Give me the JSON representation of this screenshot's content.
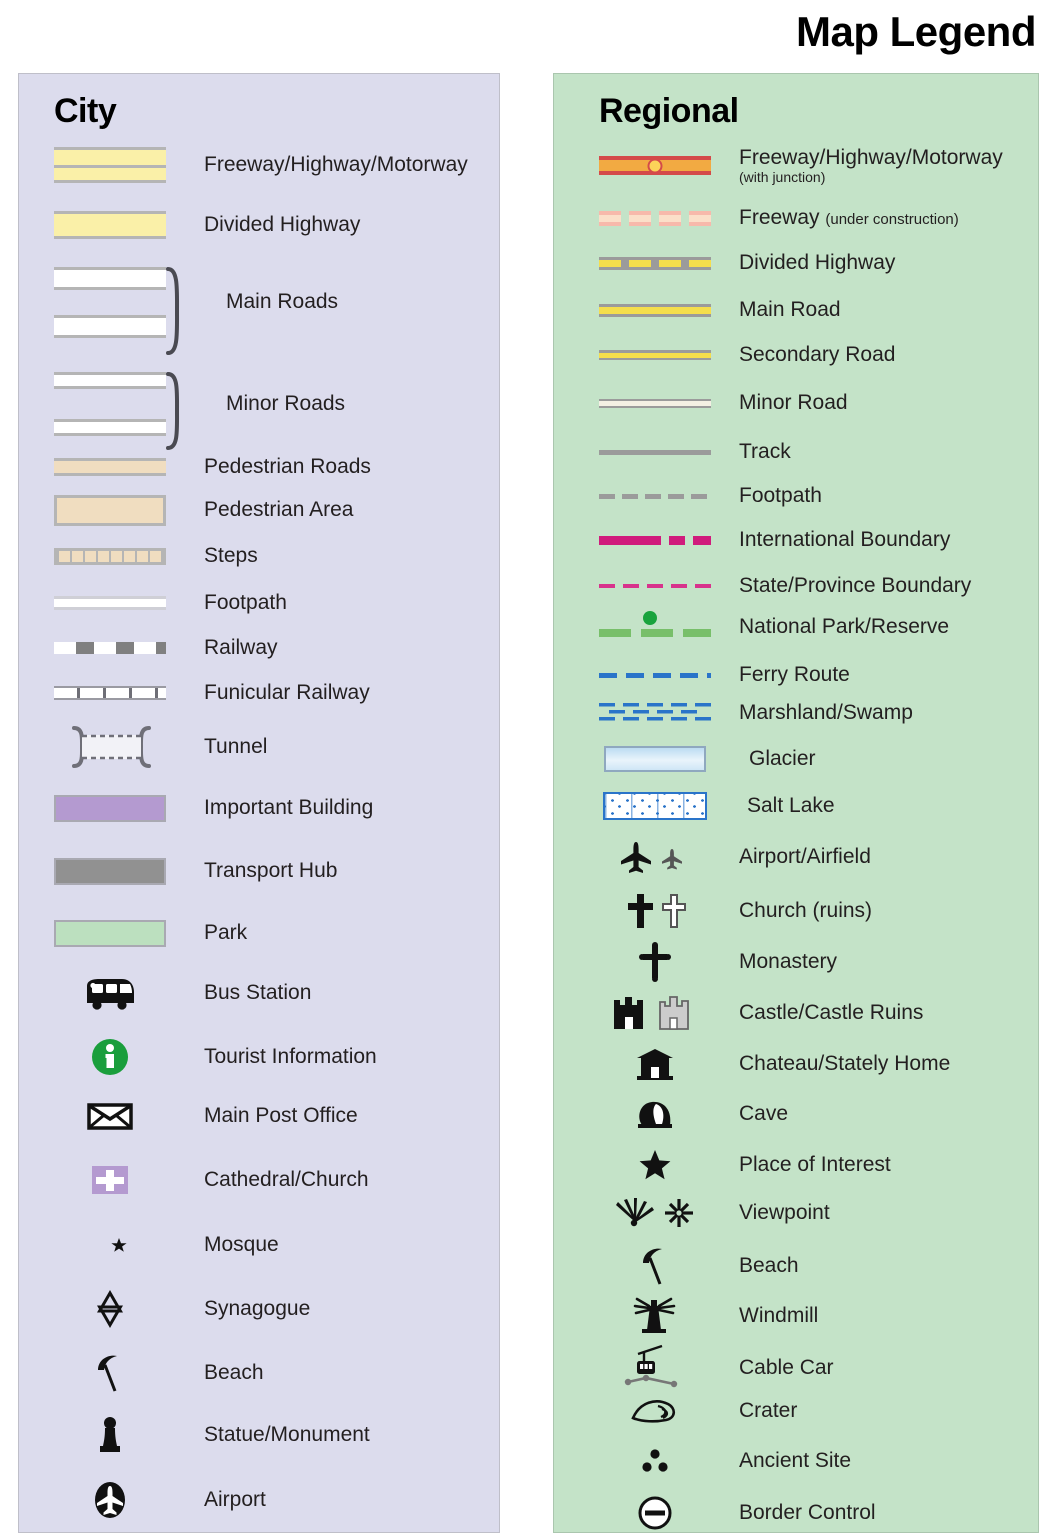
{
  "title": "Map Legend",
  "city": {
    "heading": "City",
    "bg": "#dcdced",
    "items": [
      {
        "label": "Freeway/Highway/Motorway",
        "symbol": "freeway-double-band"
      },
      {
        "label": "Divided Highway",
        "symbol": "divided-highway-band"
      },
      {
        "label": "Main Roads",
        "symbol": "main-roads-braced-pair"
      },
      {
        "label": "Minor Roads",
        "symbol": "minor-roads-braced-pair"
      },
      {
        "label": "Pedestrian Roads",
        "symbol": "pedestrian-road-band"
      },
      {
        "label": "Pedestrian Area",
        "symbol": "pedestrian-area-box"
      },
      {
        "label": "Steps",
        "symbol": "steps-hatched-band"
      },
      {
        "label": "Footpath",
        "symbol": "footpath-thin-line"
      },
      {
        "label": "Railway",
        "symbol": "railway-dashed-bar"
      },
      {
        "label": "Funicular Railway",
        "symbol": "funicular-ticked-line"
      },
      {
        "label": "Tunnel",
        "symbol": "tunnel-bracket-dashed"
      },
      {
        "label": "Important Building",
        "symbol": "important-building-swatch"
      },
      {
        "label": "Transport Hub",
        "symbol": "transport-hub-swatch"
      },
      {
        "label": "Park",
        "symbol": "park-swatch"
      },
      {
        "label": "Bus Station",
        "symbol": "bus-icon"
      },
      {
        "label": "Tourist Information",
        "symbol": "information-icon"
      },
      {
        "label": "Main Post Office",
        "symbol": "envelope-icon"
      },
      {
        "label": "Cathedral/Church",
        "symbol": "cross-square-icon"
      },
      {
        "label": "Mosque",
        "symbol": "crescent-star-icon"
      },
      {
        "label": "Synagogue",
        "symbol": "star-of-david-icon"
      },
      {
        "label": "Beach",
        "symbol": "parasol-icon"
      },
      {
        "label": "Statue/Monument",
        "symbol": "statue-icon"
      },
      {
        "label": "Airport",
        "symbol": "airport-circle-icon"
      }
    ]
  },
  "regional": {
    "heading": "Regional",
    "bg": "#c4e3c8",
    "items": [
      {
        "label": "Freeway/Highway/Motorway",
        "sub": "(with junction)",
        "symbol": "freeway-junction-line"
      },
      {
        "label": "Freeway ",
        "inline_sub": "(under construction)",
        "symbol": "freeway-under-construction-line"
      },
      {
        "label": "Divided Highway",
        "symbol": "divided-highway-line"
      },
      {
        "label": "Main Road",
        "symbol": "main-road-line"
      },
      {
        "label": "Secondary Road",
        "symbol": "secondary-road-line"
      },
      {
        "label": "Minor Road",
        "symbol": "minor-road-line"
      },
      {
        "label": "Track",
        "symbol": "track-line"
      },
      {
        "label": "Footpath",
        "symbol": "footpath-dashed-line"
      },
      {
        "label": "International Boundary",
        "symbol": "international-boundary-line"
      },
      {
        "label": "State/Province Boundary",
        "symbol": "state-boundary-line"
      },
      {
        "label": "National Park/Reserve",
        "symbol": "national-park-line"
      },
      {
        "label": "Ferry Route",
        "symbol": "ferry-route-line"
      },
      {
        "label": "Marshland/Swamp",
        "symbol": "marshland-pattern"
      },
      {
        "label": "Glacier",
        "symbol": "glacier-swatch"
      },
      {
        "label": "Salt Lake",
        "symbol": "salt-lake-swatch"
      },
      {
        "label": "Airport/Airfield",
        "symbol": "airplane-pair-icon"
      },
      {
        "label": "Church (ruins)",
        "symbol": "cross-pair-icon"
      },
      {
        "label": "Monastery",
        "symbol": "monastery-cross-icon"
      },
      {
        "label": "Castle/Castle Ruins",
        "symbol": "castle-pair-icon"
      },
      {
        "label": "Chateau/Stately Home",
        "symbol": "chateau-icon"
      },
      {
        "label": "Cave",
        "symbol": "cave-icon"
      },
      {
        "label": "Place of Interest",
        "symbol": "star-icon"
      },
      {
        "label": "Viewpoint",
        "symbol": "viewpoint-pair-icon"
      },
      {
        "label": "Beach",
        "symbol": "parasol-icon"
      },
      {
        "label": "Windmill",
        "symbol": "windmill-icon"
      },
      {
        "label": "Cable Car",
        "symbol": "cable-car-icon"
      },
      {
        "label": "Crater",
        "symbol": "crater-icon"
      },
      {
        "label": "Ancient Site",
        "symbol": "ancient-site-icon"
      },
      {
        "label": "Border Control",
        "symbol": "border-control-icon"
      }
    ]
  },
  "colors": {
    "city_panel": "#dcdced",
    "regional_panel": "#c4e3c8",
    "highway_yellow": "#faf0a8",
    "pedestrian_tan": "#f0ddc0",
    "important_building": "#b49ad0",
    "transport_hub": "#919191",
    "park_green": "#bce0bf",
    "freeway_red": "#d44a4a",
    "freeway_orange": "#f2aa42",
    "junction_yellow": "#fcd359",
    "road_yellow": "#f5de4c",
    "boundary_magenta": "#d01b7c",
    "park_line_green": "#78bf6a",
    "ferry_blue": "#2a74c9",
    "info_green": "#1a9e3c"
  }
}
